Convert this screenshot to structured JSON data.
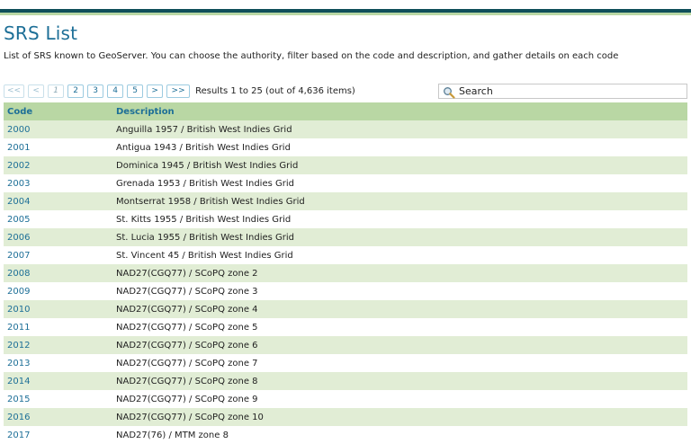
{
  "page": {
    "title": "SRS List",
    "description": "List of SRS known to GeoServer. You can choose the authority, filter based on the code and description, and gather details on each code"
  },
  "pager": {
    "first": "<<",
    "prev": "<",
    "pages": [
      "1",
      "2",
      "3",
      "4",
      "5"
    ],
    "current_page": "1",
    "next": ">",
    "last": ">>",
    "results": "Results 1 to 25 (out of 4,636 items)"
  },
  "search": {
    "placeholder": "Search",
    "icon": "magnifier-icon"
  },
  "table": {
    "headers": {
      "code": "Code",
      "description": "Description"
    },
    "rows": [
      {
        "code": "2000",
        "description": "Anguilla 1957 / British West Indies Grid"
      },
      {
        "code": "2001",
        "description": "Antigua 1943 / British West Indies Grid"
      },
      {
        "code": "2002",
        "description": "Dominica 1945 / British West Indies Grid"
      },
      {
        "code": "2003",
        "description": "Grenada 1953 / British West Indies Grid"
      },
      {
        "code": "2004",
        "description": "Montserrat 1958 / British West Indies Grid"
      },
      {
        "code": "2005",
        "description": "St. Kitts 1955 / British West Indies Grid"
      },
      {
        "code": "2006",
        "description": "St. Lucia 1955 / British West Indies Grid"
      },
      {
        "code": "2007",
        "description": "St. Vincent 45 / British West Indies Grid"
      },
      {
        "code": "2008",
        "description": "NAD27(CGQ77) / SCoPQ zone 2"
      },
      {
        "code": "2009",
        "description": "NAD27(CGQ77) / SCoPQ zone 3"
      },
      {
        "code": "2010",
        "description": "NAD27(CGQ77) / SCoPQ zone 4"
      },
      {
        "code": "2011",
        "description": "NAD27(CGQ77) / SCoPQ zone 5"
      },
      {
        "code": "2012",
        "description": "NAD27(CGQ77) / SCoPQ zone 6"
      },
      {
        "code": "2013",
        "description": "NAD27(CGQ77) / SCoPQ zone 7"
      },
      {
        "code": "2014",
        "description": "NAD27(CGQ77) / SCoPQ zone 8"
      },
      {
        "code": "2015",
        "description": "NAD27(CGQ77) / SCoPQ zone 9"
      },
      {
        "code": "2016",
        "description": "NAD27(CGQ77) / SCoPQ zone 10"
      },
      {
        "code": "2017",
        "description": "NAD27(76) / MTM zone 8"
      }
    ]
  },
  "colors": {
    "accent": "#1d6f97",
    "header_bg": "#b9d7a4",
    "row_alt_bg": "#e1edd5",
    "top_bar": "#0f4f5a"
  }
}
